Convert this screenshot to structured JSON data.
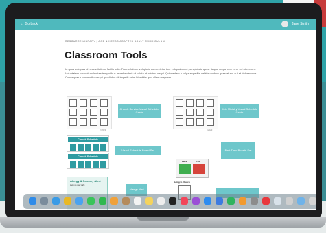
{
  "topbar": {
    "back_label": "← Go back",
    "user_name": "Jane Smith"
  },
  "breadcrumb": "RESOURCE LIBRARY | AGE & NEEDS ADAPTED ADULT CURRICULUM",
  "page_title": "Classroom Tools",
  "intro": "In quos voluptas id necessitatibus facilis odio. Facere labore voluptate consectetur iure voluptatum et perspiciatis quos. Itaque neque eos error vel ut veniam. Voluptatem corrupti molestiae temporibus reprehenderit ut soluta et minima sequi. Quibusdam a culpa expedita debitis quidem quaerat aut aut et doloremque. Consequatur commodi corrupti quod id ut sit impedit enim blanditiis quo ullam magnam.",
  "buttons": {
    "church_service_visual": "Church Service Visual Schedule Cards",
    "kids_ministry_visual": "Kids Ministry Visual Schedule Cards",
    "visual_schedule_board": "Visual Schedule Board Set",
    "first_then_boards": "First Then Boards Set",
    "allergy_alert": "Allergy Alert"
  },
  "schedule_boards": {
    "board_1_title": "Church Schedule",
    "board_2_title": "Church Schedule"
  },
  "first_then": {
    "first_label": "FIRST",
    "then_label": "THEN"
  },
  "allergy_card": {
    "title": "Allergy & Sensory Alert",
    "subtitle": "Help us stay safe"
  },
  "church_card": {
    "title": "Going to Church"
  },
  "thumb_credits": {
    "credit_1": "©2023",
    "credit_2": "©2023"
  },
  "colors": {
    "topbar": "#4fb9bd",
    "button": "#6ec7cb",
    "schedule": "#2f9ba1",
    "first": "#3fae4f",
    "then": "#d6443b"
  },
  "dock": [
    {
      "name": "finder-icon",
      "color": "#2f8be8"
    },
    {
      "name": "launchpad-icon",
      "color": "#7a8c9c"
    },
    {
      "name": "safari-icon",
      "color": "#3a9be6"
    },
    {
      "name": "chrome-icon",
      "color": "#e9b824"
    },
    {
      "name": "mail-icon",
      "color": "#4aa3f0"
    },
    {
      "name": "messages-icon",
      "color": "#39c45a"
    },
    {
      "name": "facetime-icon",
      "color": "#2fb84f"
    },
    {
      "name": "photos-icon",
      "color": "#f0a13a"
    },
    {
      "name": "contacts-icon",
      "color": "#b58b5c"
    },
    {
      "name": "calendar-icon",
      "color": "#f3f3f3"
    },
    {
      "name": "notes-icon",
      "color": "#f4d35e"
    },
    {
      "name": "reminders-icon",
      "color": "#eeeeee"
    },
    {
      "name": "tv-icon",
      "color": "#222222"
    },
    {
      "name": "music-icon",
      "color": "#f2465a"
    },
    {
      "name": "podcasts-icon",
      "color": "#9b4fd6"
    },
    {
      "name": "appstore-icon",
      "color": "#2d8cf0"
    },
    {
      "name": "keynote-icon",
      "color": "#3d7be0"
    },
    {
      "name": "numbers-icon",
      "color": "#2fb35f"
    },
    {
      "name": "pages-icon",
      "color": "#f29a2e"
    },
    {
      "name": "settings-icon",
      "color": "#8c8c8c"
    },
    {
      "name": "news-icon",
      "color": "#e8383d"
    },
    {
      "name": "preview-icon",
      "color": "#d9e2ea"
    },
    {
      "name": "help-icon",
      "color": "#cfcfcf"
    },
    {
      "name": "folder-icon",
      "color": "#6fb3e9"
    },
    {
      "name": "trash-icon",
      "color": "#d5d5d5"
    }
  ]
}
